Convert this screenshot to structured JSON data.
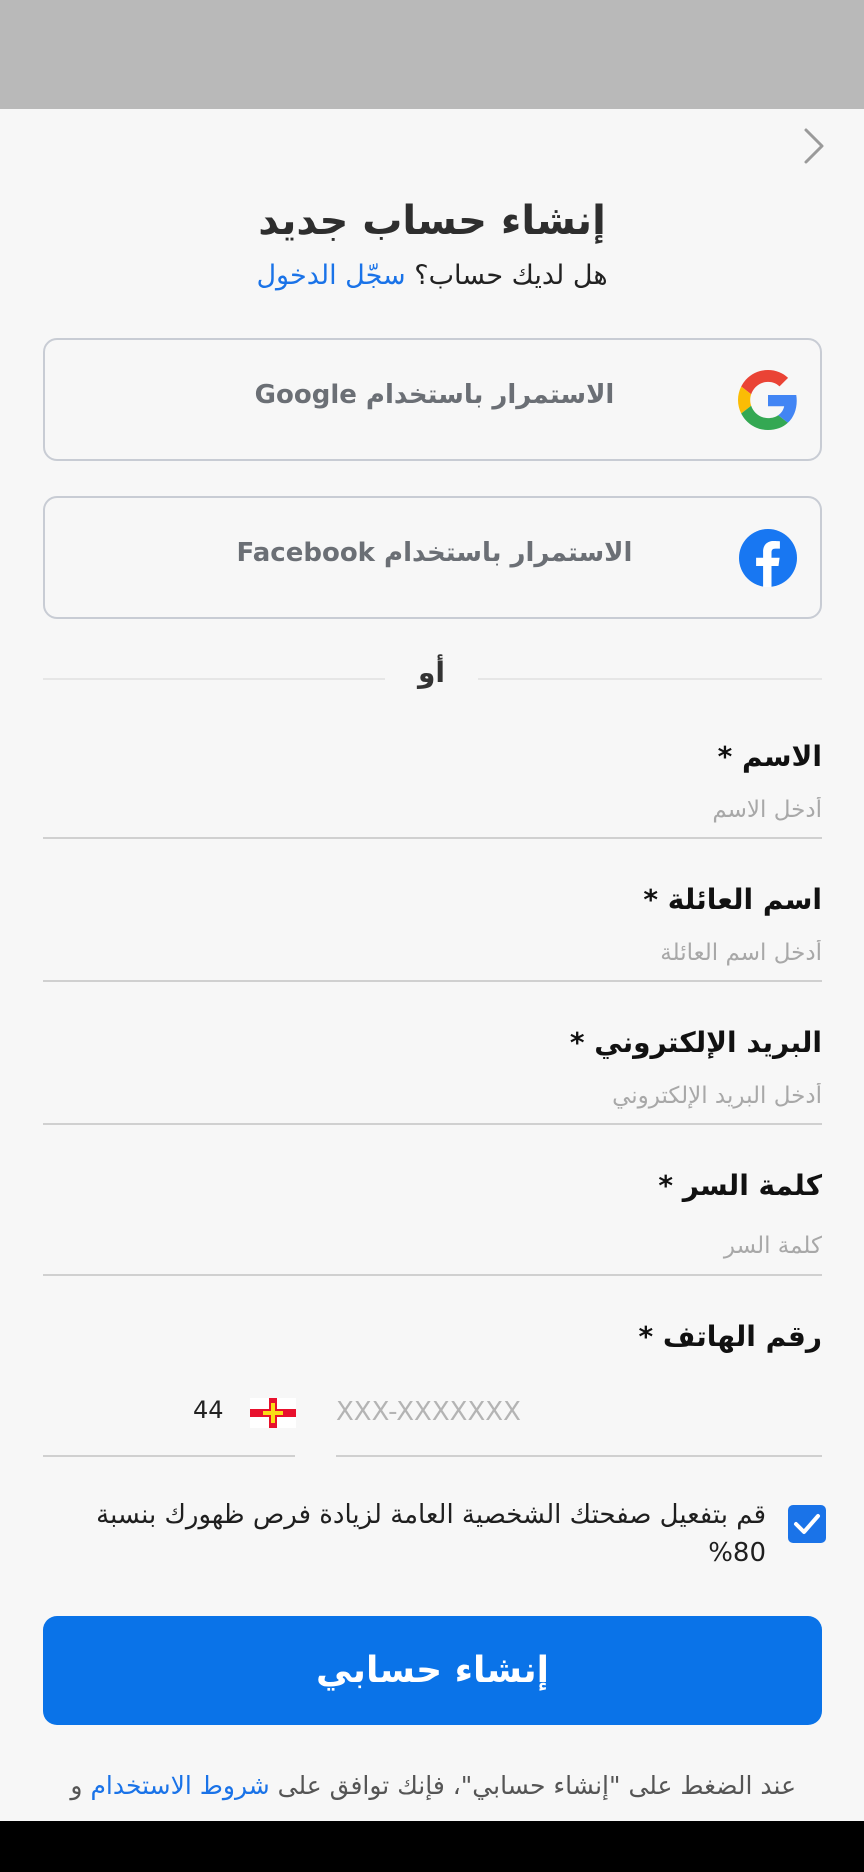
{
  "header": {
    "title": "إنشاء حساب جديد",
    "has_account_text": "هل لديك حساب؟",
    "login_link": "سجّل الدخول"
  },
  "social": {
    "google_label": "الاستمرار باستخدام Google",
    "facebook_label": "الاستمرار باستخدام Facebook"
  },
  "divider": {
    "or_text": "أو"
  },
  "form": {
    "first_name": {
      "label": "الاسم *",
      "placeholder": "أدخل الاسم",
      "value": ""
    },
    "last_name": {
      "label": "اسم العائلة *",
      "placeholder": "أدخل اسم العائلة",
      "value": ""
    },
    "email": {
      "label": "البريد الإلكتروني *",
      "placeholder": "أدخل البريد الإلكتروني",
      "value": ""
    },
    "password": {
      "label": "كلمة السر  *",
      "placeholder": "كلمة السر",
      "value": ""
    },
    "phone": {
      "label": "رقم الهاتف *",
      "country_code": "44",
      "placeholder": "XXX-XXXXXXX",
      "value": ""
    }
  },
  "profile_opt_in": {
    "checked": true,
    "text": "قم بتفعيل صفحتك الشخصية العامة لزيادة فرص ظهورك بنسبة 80%"
  },
  "submit": {
    "label": "إنشاء حسابي"
  },
  "terms": {
    "prefix": "عند الضغط على \"إنشاء حسابي\"، فإنك توافق على ",
    "link": "شروط الاستخدام",
    "suffix": "  و"
  },
  "colors": {
    "accent": "#0a73e8",
    "link": "#1a73e8",
    "status_bar": "#b9b9b9",
    "background": "#f7f7f7"
  },
  "icons": {
    "back": "chevron-right-icon",
    "google": "google-icon",
    "facebook": "facebook-icon",
    "flag": "guernsey-flag-icon",
    "check": "checkmark-icon"
  }
}
